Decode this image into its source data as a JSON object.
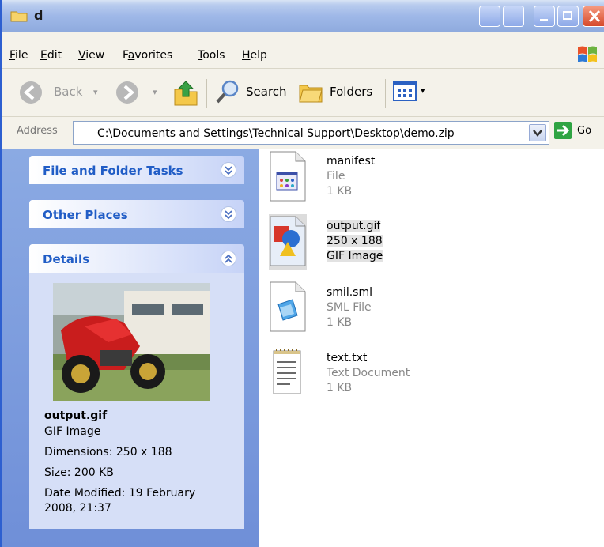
{
  "window": {
    "title": "d"
  },
  "menu": {
    "items": [
      {
        "key": "F",
        "rest": "ile"
      },
      {
        "key": "E",
        "rest": "dit"
      },
      {
        "key": "V",
        "rest": "iew"
      },
      {
        "key": "a",
        "pre": "F",
        "rest": "vorites"
      },
      {
        "key": "T",
        "rest": "ools"
      },
      {
        "key": "H",
        "rest": "elp"
      }
    ]
  },
  "toolbar": {
    "back_label": "Back",
    "search_label": "Search",
    "folders_label": "Folders"
  },
  "address": {
    "label": "Address",
    "value": "C:\\Documents and Settings\\Technical Support\\Desktop\\demo.zip",
    "go_label": "Go"
  },
  "left_pane": {
    "panels": [
      {
        "title": "File and Folder Tasks"
      },
      {
        "title": "Other Places"
      },
      {
        "title": "Details"
      }
    ],
    "details": {
      "name": "output.gif",
      "type": "GIF Image",
      "dimensions": "Dimensions: 250 x 188",
      "size": "Size: 200 KB",
      "modified_line1": "Date Modified: 19 February",
      "modified_line2": "2008, 21:37"
    }
  },
  "files": [
    {
      "name": "manifest",
      "line2": "File",
      "line3": "1 KB",
      "icon": "manifest-icon"
    },
    {
      "name": "output.gif",
      "line2": "250 x 188",
      "line3": "GIF Image",
      "icon": "gif-image-icon",
      "selected": true
    },
    {
      "name": "smil.sml",
      "line2": "SML File",
      "line3": "1 KB",
      "icon": "sml-file-icon"
    },
    {
      "name": "text.txt",
      "line2": "Text Document",
      "line3": "1 KB",
      "icon": "text-document-icon"
    }
  ]
}
